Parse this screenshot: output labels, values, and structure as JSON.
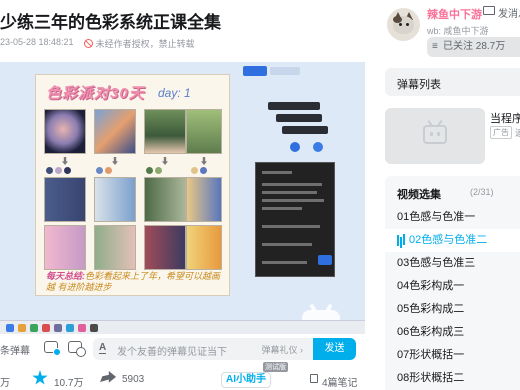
{
  "video": {
    "title": "少练三年的色彩系统正课全集",
    "datetime": "23-05-28 18:48:21",
    "copyright": "未经作者授权，禁止转载"
  },
  "frame": {
    "page_title": "色彩派对30天",
    "day_label": "day: 1",
    "summary_label": "每天总结:",
    "summary_text": "色彩看起来上了年，希望可以越画越 有进阶越进步"
  },
  "danmaku_bar": {
    "label": "条弹幕",
    "placeholder": "发个友善的弹幕见证当下",
    "rule_link": "弹幕礼仪",
    "send_label": "发送"
  },
  "stats": {
    "likes": "万",
    "favorites": "10.7万",
    "shares": "5903",
    "ai_label": "AI小助手",
    "test_tag": "测试版",
    "notes": "4篇笔记"
  },
  "uploader": {
    "name": "辣鱼中下游",
    "message_label": "发消息",
    "description": "wb: 咸鱼中下游",
    "follow_label": "已关注 28.7万"
  },
  "sidebar": {
    "danmaku_list_label": "弹幕列表",
    "ad_title": "当程序",
    "ad_tag": "广告",
    "ad_more": "追"
  },
  "playlist": {
    "title": "视频选集",
    "count": "(2/31)",
    "items": [
      {
        "label": "01色感与色准一"
      },
      {
        "label": "02色感与色准二"
      },
      {
        "label": "03色感与色准三"
      },
      {
        "label": "04色彩构成一"
      },
      {
        "label": "05色彩构成二"
      },
      {
        "label": "06色彩构成三"
      },
      {
        "label": "07形状概括一"
      },
      {
        "label": "08形状概括二"
      }
    ],
    "active_index": 1
  },
  "colors": {
    "accent": "#00aeec",
    "uploader_name": "#fb7299"
  }
}
